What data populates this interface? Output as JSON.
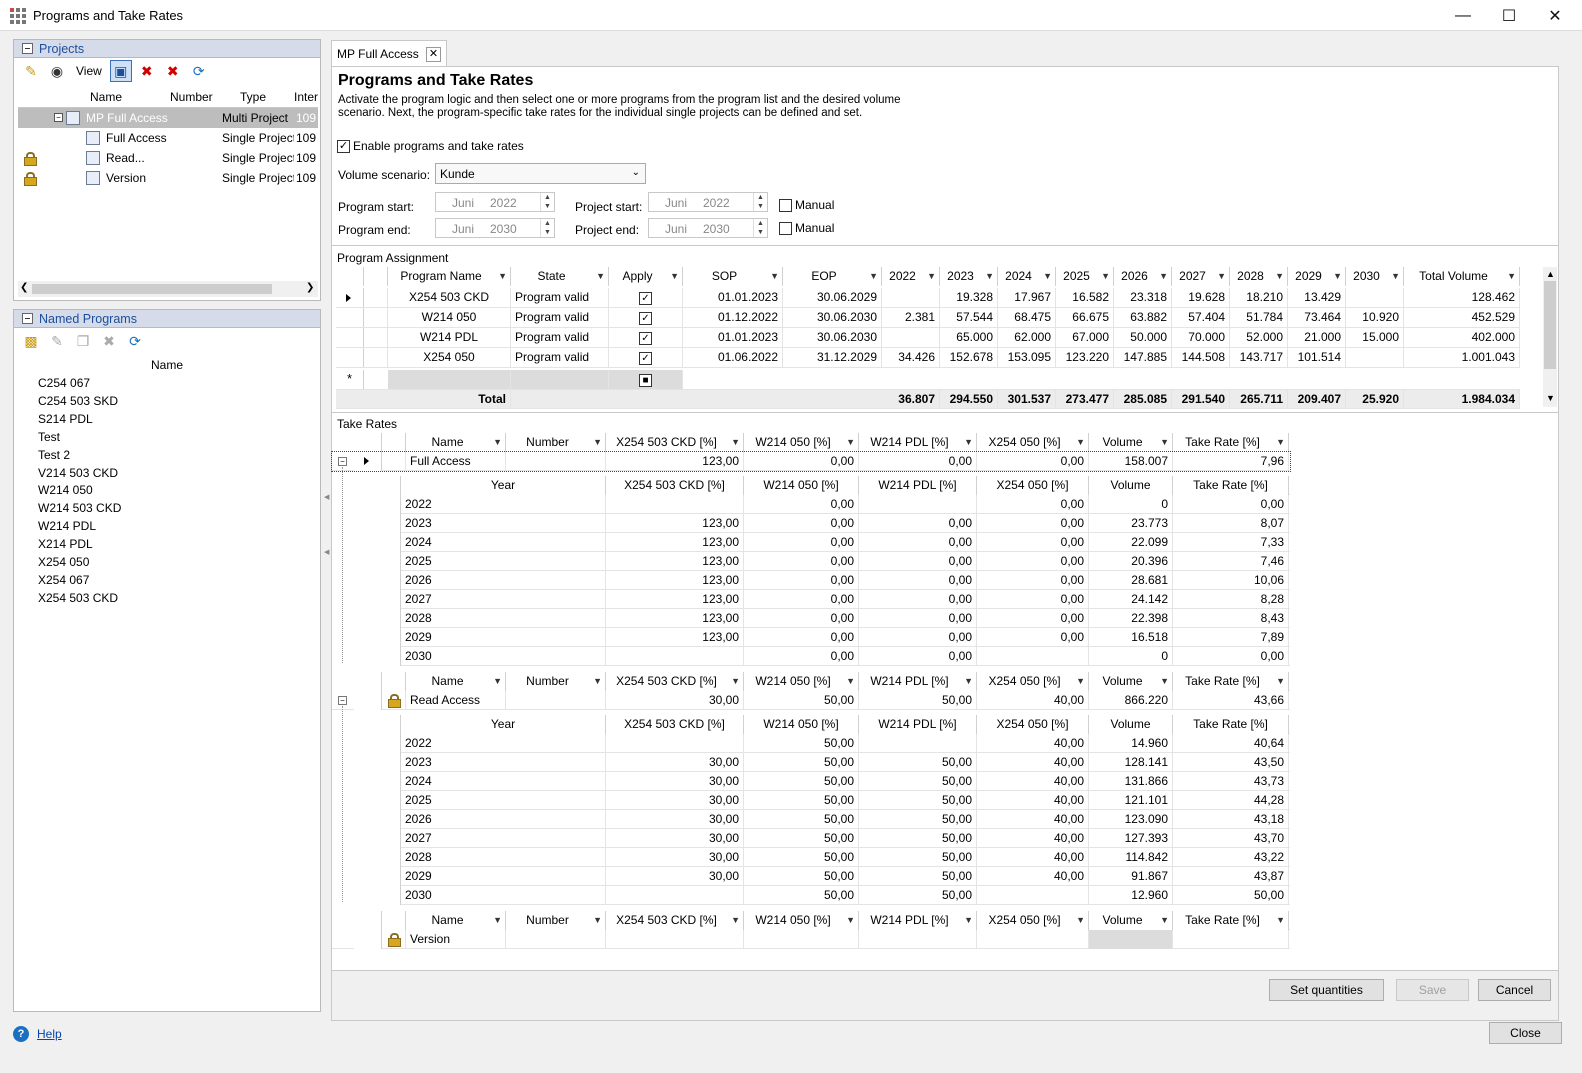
{
  "window": {
    "title": "Programs and Take Rates"
  },
  "projects_panel": {
    "title": "Projects",
    "toolbar": {
      "view_label": "View"
    },
    "columns": [
      "Name",
      "Number",
      "Type",
      "Inter"
    ],
    "rows": [
      {
        "name": "MP Full Access",
        "number": "",
        "type": "Multi Project",
        "inter": "109",
        "locked": false,
        "selected": true
      },
      {
        "name": "Full Access",
        "number": "",
        "type": "Single Project",
        "inter": "109",
        "locked": false,
        "selected": false
      },
      {
        "name": "Read...",
        "number": "",
        "type": "Single Project",
        "inter": "109",
        "locked": true,
        "selected": false
      },
      {
        "name": "Version",
        "number": "",
        "type": "Single Project",
        "inter": "109",
        "locked": true,
        "selected": false
      }
    ]
  },
  "named_programs_panel": {
    "title": "Named Programs",
    "column": "Name",
    "items": [
      "C254 067",
      "C254 503 SKD",
      "S214 PDL",
      "Test",
      "Test 2",
      "V214 503 CKD",
      "W214 050",
      "W214 503 CKD",
      "W214 PDL",
      "X214 PDL",
      "X254 050",
      "X254 067",
      "X254 503 CKD"
    ]
  },
  "help_link": "Help",
  "tab": {
    "label": "MP Full Access"
  },
  "main": {
    "heading": "Programs and Take Rates",
    "description_line1": "Activate the program logic and then select one or more programs from the program list and the desired volume",
    "description_line2": "scenario. Next, the program-specific take rates for the individual single projects can be defined and set.",
    "enable_label": "Enable programs and take rates",
    "enable_checked": true,
    "volume_scenario_label": "Volume scenario:",
    "volume_scenario_value": "Kunde",
    "program_start_label": "Program start:",
    "program_end_label": "Program end:",
    "project_start_label": "Project start:",
    "project_end_label": "Project end:",
    "program_start": {
      "month": "Juni",
      "year": "2022"
    },
    "program_end": {
      "month": "Juni",
      "year": "2030"
    },
    "project_start": {
      "month": "Juni",
      "year": "2022"
    },
    "project_end": {
      "month": "Juni",
      "year": "2030"
    },
    "manual_label": "Manual"
  },
  "program_assignment": {
    "title": "Program Assignment",
    "columns": [
      "Program Name",
      "State",
      "Apply",
      "SOP",
      "EOP",
      "2022",
      "2023",
      "2024",
      "2025",
      "2026",
      "2027",
      "2028",
      "2029",
      "2030",
      "Total Volume"
    ],
    "rows": [
      [
        "X254 503 CKD",
        "Program valid",
        "",
        "01.01.2023",
        "30.06.2029",
        "",
        "19.328",
        "17.967",
        "16.582",
        "23.318",
        "19.628",
        "18.210",
        "13.429",
        "",
        "128.462"
      ],
      [
        "W214 050",
        "Program valid",
        "",
        "01.12.2022",
        "30.06.2030",
        "2.381",
        "57.544",
        "68.475",
        "66.675",
        "63.882",
        "57.404",
        "51.784",
        "73.464",
        "10.920",
        "452.529"
      ],
      [
        "W214 PDL",
        "Program valid",
        "",
        "01.01.2023",
        "30.06.2030",
        "",
        "65.000",
        "62.000",
        "67.000",
        "50.000",
        "70.000",
        "52.000",
        "21.000",
        "15.000",
        "402.000"
      ],
      [
        "X254 050",
        "Program valid",
        "",
        "01.06.2022",
        "31.12.2029",
        "34.426",
        "152.678",
        "153.095",
        "123.220",
        "147.885",
        "144.508",
        "143.717",
        "101.514",
        "",
        "1.001.043"
      ]
    ],
    "total_label": "Total",
    "totals": [
      "36.807",
      "294.550",
      "301.537",
      "273.477",
      "285.085",
      "291.540",
      "265.711",
      "209.407",
      "25.920",
      "1.984.034"
    ]
  },
  "take_rates": {
    "title": "Take Rates",
    "columns": [
      "Name",
      "Number",
      "X254 503 CKD [%]",
      "W214 050 [%]",
      "W214 PDL [%]",
      "X254 050 [%]",
      "Volume",
      "Take Rate [%]"
    ],
    "sub_columns": [
      "Year",
      "X254 503 CKD [%]",
      "W214 050 [%]",
      "W214 PDL [%]",
      "X254 050 [%]",
      "Volume",
      "Take Rate [%]"
    ],
    "groups": [
      {
        "name": "Full Access",
        "locked": false,
        "values": [
          "",
          "123,00",
          "0,00",
          "0,00",
          "0,00",
          "158.007",
          "7,96"
        ],
        "years": [
          [
            "2022",
            "",
            "0,00",
            "",
            "0,00",
            "0",
            "0,00"
          ],
          [
            "2023",
            "123,00",
            "0,00",
            "0,00",
            "0,00",
            "23.773",
            "8,07"
          ],
          [
            "2024",
            "123,00",
            "0,00",
            "0,00",
            "0,00",
            "22.099",
            "7,33"
          ],
          [
            "2025",
            "123,00",
            "0,00",
            "0,00",
            "0,00",
            "20.396",
            "7,46"
          ],
          [
            "2026",
            "123,00",
            "0,00",
            "0,00",
            "0,00",
            "28.681",
            "10,06"
          ],
          [
            "2027",
            "123,00",
            "0,00",
            "0,00",
            "0,00",
            "24.142",
            "8,28"
          ],
          [
            "2028",
            "123,00",
            "0,00",
            "0,00",
            "0,00",
            "22.398",
            "8,43"
          ],
          [
            "2029",
            "123,00",
            "0,00",
            "0,00",
            "0,00",
            "16.518",
            "7,89"
          ],
          [
            "2030",
            "",
            "0,00",
            "0,00",
            "",
            "0",
            "0,00"
          ]
        ]
      },
      {
        "name": "Read Access",
        "locked": true,
        "values": [
          "",
          "30,00",
          "50,00",
          "50,00",
          "40,00",
          "866.220",
          "43,66"
        ],
        "years": [
          [
            "2022",
            "",
            "50,00",
            "",
            "40,00",
            "14.960",
            "40,64"
          ],
          [
            "2023",
            "30,00",
            "50,00",
            "50,00",
            "40,00",
            "128.141",
            "43,50"
          ],
          [
            "2024",
            "30,00",
            "50,00",
            "50,00",
            "40,00",
            "131.866",
            "43,73"
          ],
          [
            "2025",
            "30,00",
            "50,00",
            "50,00",
            "40,00",
            "121.101",
            "44,28"
          ],
          [
            "2026",
            "30,00",
            "50,00",
            "50,00",
            "40,00",
            "123.090",
            "43,18"
          ],
          [
            "2027",
            "30,00",
            "50,00",
            "50,00",
            "40,00",
            "127.393",
            "43,70"
          ],
          [
            "2028",
            "30,00",
            "50,00",
            "50,00",
            "40,00",
            "114.842",
            "43,22"
          ],
          [
            "2029",
            "30,00",
            "50,00",
            "50,00",
            "40,00",
            "91.867",
            "43,87"
          ],
          [
            "2030",
            "",
            "50,00",
            "50,00",
            "",
            "12.960",
            "50,00"
          ]
        ]
      },
      {
        "name": "Version",
        "locked": true,
        "values": [
          "",
          "",
          "",
          "",
          "",
          "",
          ""
        ],
        "years": []
      }
    ]
  },
  "buttons": {
    "set_quantities": "Set quantities",
    "save": "Save",
    "cancel": "Cancel",
    "close": "Close"
  }
}
